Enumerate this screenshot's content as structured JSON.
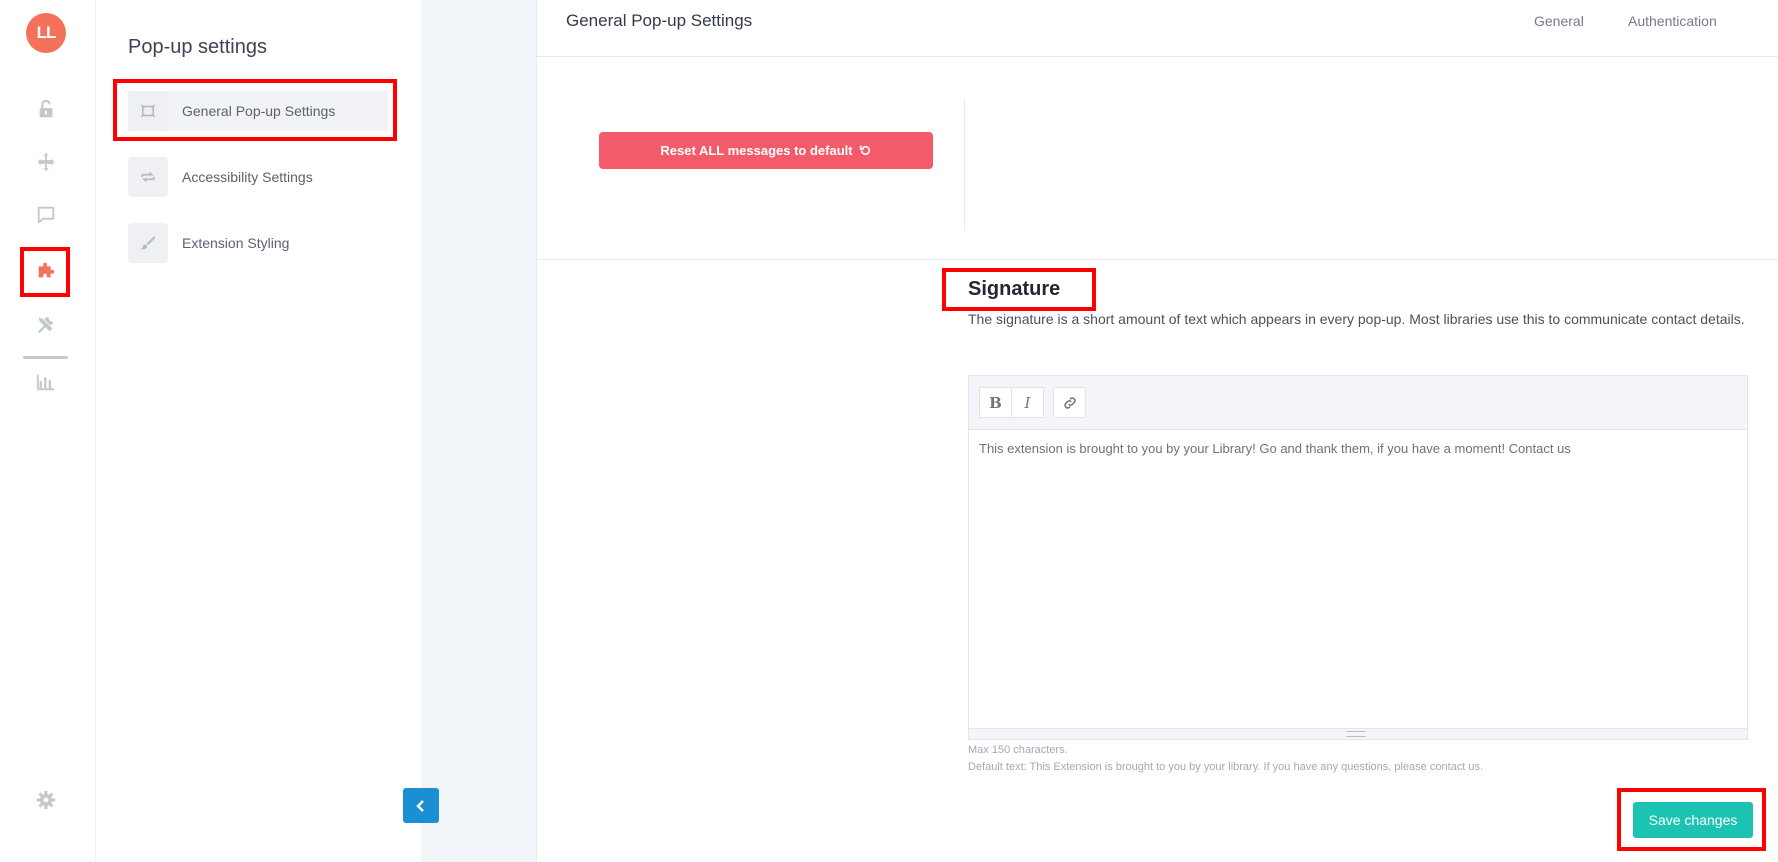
{
  "app": {
    "logo_text": "LL",
    "brand_color": "#f4725b",
    "highlight_color": "#ff0000"
  },
  "rail": {
    "items": [
      {
        "icon": "unlock-icon",
        "active": false
      },
      {
        "icon": "move-arrows-icon",
        "active": false
      },
      {
        "icon": "chat-bubble-icon",
        "active": false
      },
      {
        "icon": "puzzle-icon",
        "active": true
      },
      {
        "icon": "tools-icon",
        "active": false
      },
      {
        "icon": "bar-chart-icon",
        "active": false
      },
      {
        "icon": "gear-icon",
        "active": false
      }
    ]
  },
  "sidebar": {
    "title": "Pop-up settings",
    "items": [
      {
        "label": "General Pop-up Settings",
        "icon": "frame-icon",
        "active": true
      },
      {
        "label": "Accessibility Settings",
        "icon": "swap-arrows-icon",
        "active": false
      },
      {
        "label": "Extension Styling",
        "icon": "brush-icon",
        "active": false
      }
    ]
  },
  "header": {
    "title": "General Pop-up Settings",
    "tabs": [
      {
        "label": "General"
      },
      {
        "label": "Authentication"
      }
    ]
  },
  "reset": {
    "button_label": "Reset ALL messages to default",
    "button_color": "#f45b6a",
    "icon": "reset-icon"
  },
  "signature": {
    "title": "Signature",
    "description": "The signature is a short amount of text which appears in every pop-up. Most libraries use this to communicate contact details.",
    "toolbar": {
      "bold_label": "B",
      "italic_label": "I",
      "link_icon": "link-icon"
    },
    "content": "This extension is brought to you by your Library! Go and thank them, if you have a moment! Contact us",
    "max_hint": "Max 150 characters.",
    "default_hint": "Default text: This Extension is brought to you by your library. If you have any questions, please contact us."
  },
  "footer": {
    "save_label": "Save changes",
    "save_color": "#1cc3b2"
  }
}
